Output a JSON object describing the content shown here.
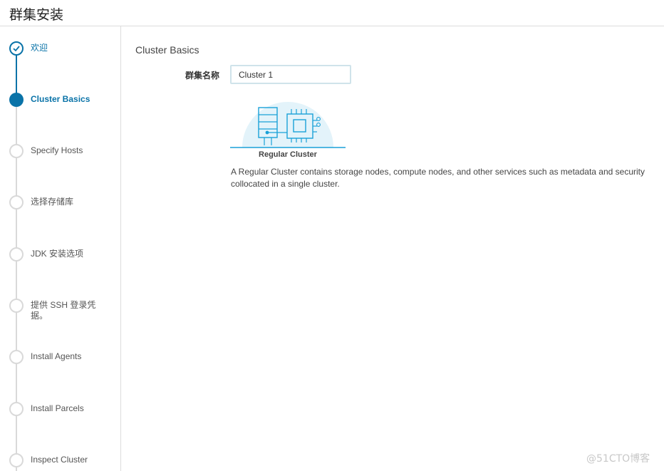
{
  "header": {
    "title": "群集安装"
  },
  "steps": [
    {
      "label": "欢迎",
      "state": "done"
    },
    {
      "label": "Cluster Basics",
      "state": "active"
    },
    {
      "label": "Specify Hosts",
      "state": "pending"
    },
    {
      "label": "选择存储库",
      "state": "pending"
    },
    {
      "label": "JDK 安装选项",
      "state": "pending"
    },
    {
      "label": "提供 SSH 登录凭据。",
      "state": "pending"
    },
    {
      "label": "Install Agents",
      "state": "pending"
    },
    {
      "label": "Install Parcels",
      "state": "pending"
    },
    {
      "label": "Inspect Cluster",
      "state": "pending"
    }
  ],
  "main": {
    "section_title": "Cluster Basics",
    "cluster_name_label": "群集名称",
    "cluster_name_value": "Cluster 1",
    "cluster_type_label": "Regular Cluster",
    "description": "A Regular Cluster contains storage nodes, compute nodes, and other services such as metadata and security collocated in a single cluster."
  },
  "watermark": "@51CTO博客",
  "colors": {
    "accent": "#0a73a8",
    "pending": "#d9d9d9",
    "illustration_bg": "#e3f3fa",
    "illustration_stroke": "#1aa1d8"
  }
}
